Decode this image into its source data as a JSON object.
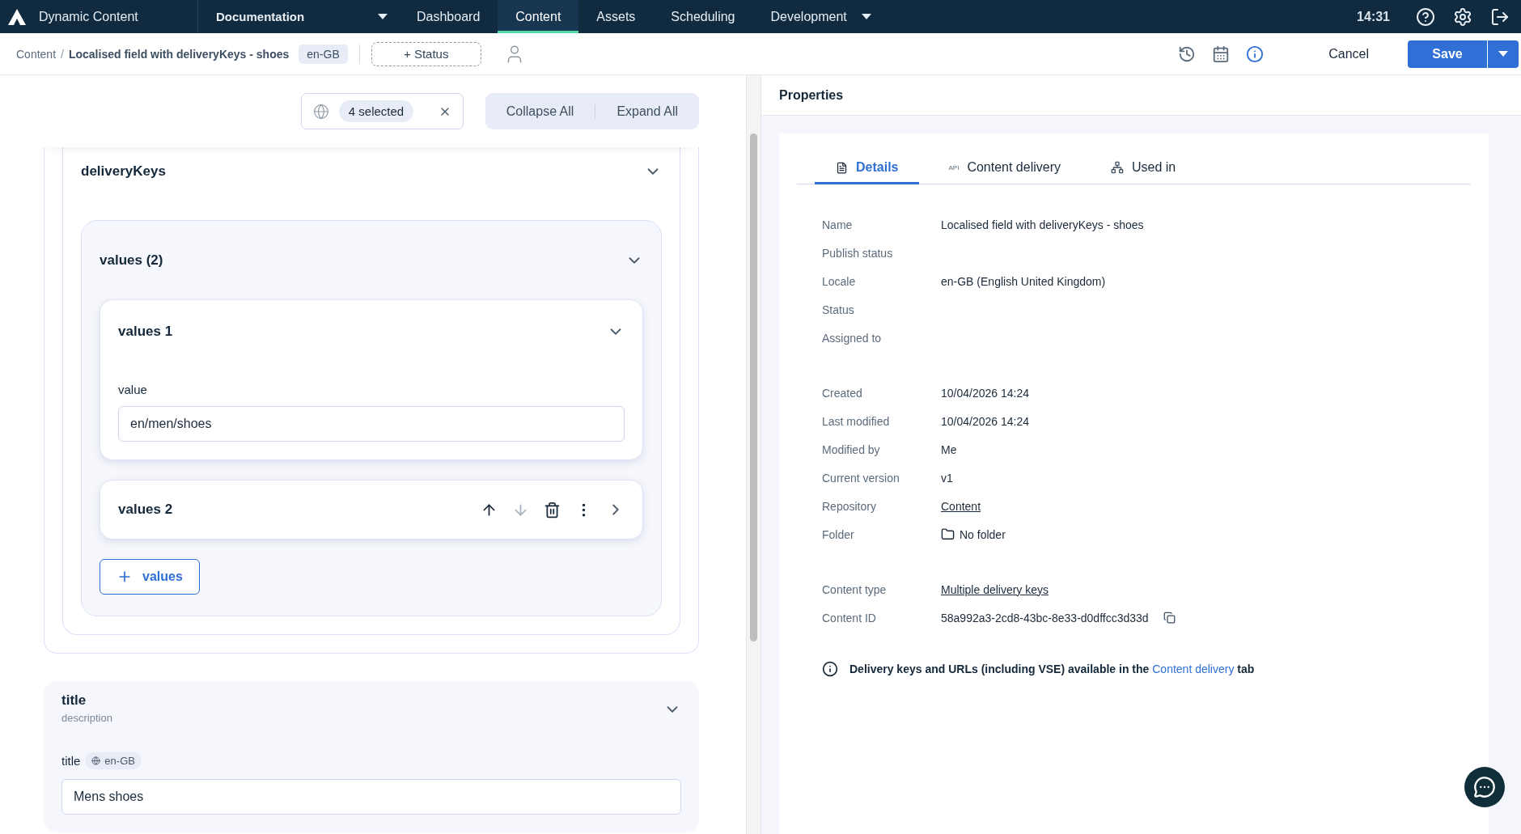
{
  "nav": {
    "app_name": "Dynamic Content",
    "hub": "Documentation",
    "items": [
      {
        "label": "Dashboard",
        "selected": false,
        "dropdown": false
      },
      {
        "label": "Content",
        "selected": true,
        "dropdown": false
      },
      {
        "label": "Assets",
        "selected": false,
        "dropdown": false
      },
      {
        "label": "Scheduling",
        "selected": false,
        "dropdown": false
      },
      {
        "label": "Development",
        "selected": false,
        "dropdown": true
      }
    ],
    "time": "14:31"
  },
  "toolbar": {
    "breadcrumb_root": "Content",
    "breadcrumb_separator": "/",
    "breadcrumb_current": "Localised field with deliveryKeys - shoes",
    "locale": "en-GB",
    "status_button": "+ Status",
    "cancel": "Cancel",
    "save": "Save"
  },
  "editor_controls": {
    "locales": "4 selected",
    "collapse": "Collapse All",
    "expand": "Expand All"
  },
  "delivery_keys": {
    "title": "deliveryKeys",
    "expanded": true,
    "list": {
      "title": "values (2)",
      "expanded": true,
      "items": [
        {
          "title": "values 1",
          "expanded": true,
          "field_label": "value",
          "value": "en/men/shoes"
        },
        {
          "title": "values 2",
          "expanded": false,
          "actions": [
            {
              "kind": "up",
              "disabled": false
            },
            {
              "kind": "down",
              "disabled": true
            },
            {
              "kind": "delete",
              "disabled": false
            },
            {
              "kind": "more",
              "disabled": false
            }
          ]
        }
      ],
      "add_button": "values"
    }
  },
  "title_field": {
    "title": "title",
    "description": "description",
    "expanded": true,
    "field_label": "title",
    "locale": "en-GB",
    "value": "Mens shoes"
  },
  "properties": {
    "heading": "Properties",
    "tabs": [
      {
        "kind": "details",
        "label": "Details",
        "selected": true
      },
      {
        "kind": "api",
        "label": "Content delivery",
        "icon_text": "API",
        "selected": false
      },
      {
        "kind": "tree",
        "label": "Used in",
        "selected": false
      }
    ],
    "row_groups": [
      [
        {
          "label": "Name",
          "kind": "text",
          "value": "Localised field with deliveryKeys - shoes"
        },
        {
          "label": "Publish status",
          "kind": "empty"
        },
        {
          "label": "Locale",
          "kind": "text",
          "value": "en-GB (English United Kingdom)"
        },
        {
          "label": "Status",
          "kind": "empty"
        },
        {
          "label": "Assigned to",
          "kind": "empty"
        }
      ],
      [
        {
          "label": "Created",
          "kind": "text",
          "value": "10/04/2026 14:24"
        },
        {
          "label": "Last modified",
          "kind": "text",
          "value": "10/04/2026 14:24"
        },
        {
          "label": "Modified by",
          "kind": "text",
          "value": "Me"
        },
        {
          "label": "Current version",
          "kind": "text",
          "value": "v1"
        },
        {
          "label": "Repository",
          "kind": "link",
          "value": "Content"
        },
        {
          "label": "Folder",
          "kind": "folder",
          "value": "No folder"
        }
      ],
      [
        {
          "label": "Content type",
          "kind": "link",
          "value": "Multiple delivery keys"
        },
        {
          "label": "Content ID",
          "kind": "copy",
          "value": "58a992a3-2cd8-43bc-8e33-d0dffcc3d33d"
        }
      ]
    ],
    "note": {
      "before": "Delivery keys and URLs (including VSE) available in the",
      "link": "Content delivery",
      "after": "tab"
    }
  }
}
